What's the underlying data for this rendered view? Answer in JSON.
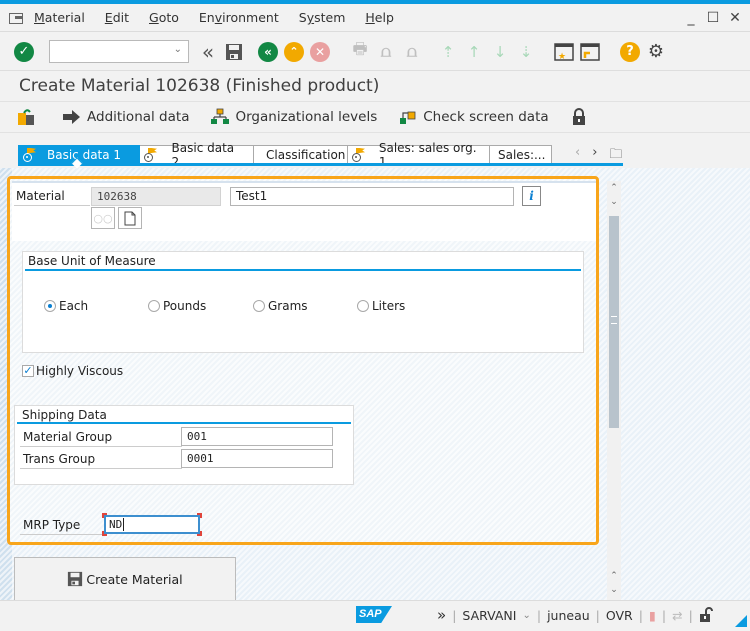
{
  "window": {
    "menu": [
      {
        "label": "Material",
        "underline": "M",
        "rest": "aterial"
      },
      {
        "label": "Edit",
        "underline": "E",
        "rest": "dit"
      },
      {
        "label": "Goto",
        "underline": "G",
        "rest": "oto"
      },
      {
        "label": "Environment",
        "pre": "En",
        "underline": "v",
        "rest": "ironment"
      },
      {
        "label": "System",
        "pre": "S",
        "underline": "y",
        "rest": "stem"
      },
      {
        "label": "Help",
        "underline": "H",
        "rest": "elp"
      }
    ],
    "controls": {
      "minimize": "_",
      "maximize": "☐",
      "close": "✕"
    }
  },
  "toolbar": {
    "command_field": {
      "value": "",
      "placeholder": ""
    },
    "icons": [
      "enter-icon",
      "back-all-icon",
      "save-icon",
      "back-icon",
      "exit-icon",
      "cancel-icon",
      "print-icon",
      "find-icon",
      "find-next-icon",
      "first-page-icon",
      "previous-page-icon",
      "next-page-icon",
      "last-page-icon",
      "new-session-icon",
      "create-shortcut-icon",
      "help-icon",
      "customize-layout-icon"
    ]
  },
  "title": "Create Material 102638 (Finished product)",
  "app_toolbar": {
    "additional_data": "Additional data",
    "org_levels": "Organizational levels",
    "check_screen": "Check screen data"
  },
  "tabs": [
    {
      "label": "Basic data 1",
      "active": true
    },
    {
      "label": "Basic data 2",
      "active": false
    },
    {
      "label": "Classification",
      "active": false
    },
    {
      "label": "Sales: sales org. 1",
      "active": false
    },
    {
      "label": "Sales:...",
      "active": false
    }
  ],
  "form": {
    "material_label": "Material",
    "material_number": "102638",
    "material_description": "Test1",
    "base_uom": {
      "title": "Base Unit of Measure",
      "options": [
        "Each",
        "Pounds",
        "Grams",
        "Liters"
      ],
      "selected": "Each"
    },
    "highly_viscous": {
      "label": "Highly Viscous",
      "checked": true
    },
    "shipping": {
      "title": "Shipping Data",
      "material_group_label": "Material Group",
      "material_group_value": "001",
      "trans_group_label": "Trans Group",
      "trans_group_value": "0001"
    },
    "mrp_type_label": "MRP Type",
    "mrp_type_value": "ND"
  },
  "create_button": "Create Material",
  "statusbar": {
    "system": "SARVANI",
    "client": "juneau",
    "mode": "OVR"
  },
  "colors": {
    "accent": "#0a9be0",
    "highlight": "#f8a51b",
    "enter_green": "#128844",
    "exit_orange": "#f2a900",
    "cancel_red": "#e9a0a0"
  }
}
